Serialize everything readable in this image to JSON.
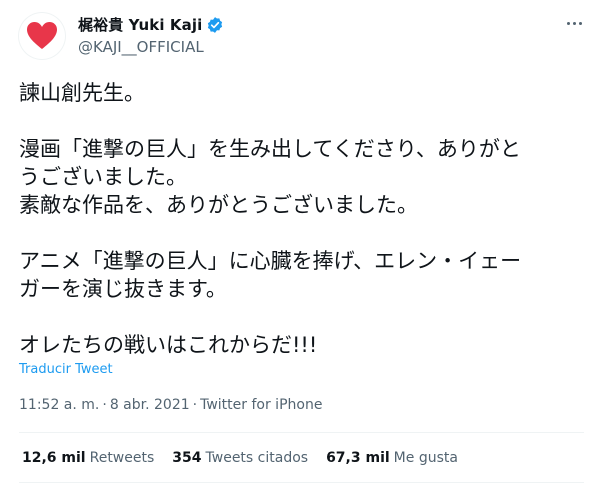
{
  "author": {
    "display_name": "梶裕貴 Yuki Kaji",
    "handle": "@KAJI__OFFICIAL",
    "avatar_icon": "heart-icon",
    "verified_icon": "verified-badge-icon",
    "colors": {
      "heart": "#e8364a",
      "verified": "#1d9bf0"
    }
  },
  "tweet": {
    "lines": [
      "諫山創先生。",
      "",
      "漫画「進撃の巨人」を生み出してくださり、ありがと",
      "うございました。",
      "素敵な作品を、ありがとうございました。",
      "",
      "アニメ「進撃の巨人」に心臓を捧げ、エレン・イェー",
      "ガーを演じ抜きます。",
      "",
      "オレたちの戦いはこれからだ!!!"
    ],
    "translate_label": "Traducir Tweet",
    "time": "11:52 a. m.",
    "separator": "·",
    "date": "8 abr. 2021",
    "source": "Twitter for iPhone"
  },
  "stats": {
    "retweets": {
      "count": "12,6 mil",
      "label": "Retweets"
    },
    "quotes": {
      "count": "354",
      "label": "Tweets citados"
    },
    "likes": {
      "count": "67,3 mil",
      "label": "Me gusta"
    }
  },
  "icons": {
    "more": "more-options-icon"
  }
}
